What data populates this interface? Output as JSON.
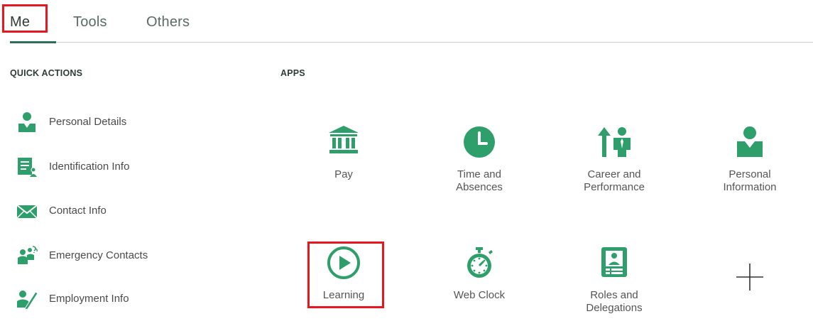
{
  "tabs": [
    {
      "label": "Me",
      "active": true
    },
    {
      "label": "Tools",
      "active": false
    },
    {
      "label": "Others",
      "active": false
    }
  ],
  "quick_actions": {
    "title": "QUICK ACTIONS",
    "items": [
      {
        "label": "Personal Details",
        "icon": "person-icon"
      },
      {
        "label": "Identification Info",
        "icon": "id-document-icon"
      },
      {
        "label": "Contact Info",
        "icon": "envelope-icon"
      },
      {
        "label": "Emergency Contacts",
        "icon": "contacts-group-icon"
      },
      {
        "label": "Employment Info",
        "icon": "person-edit-icon"
      }
    ]
  },
  "apps": {
    "title": "APPS",
    "items": [
      {
        "label_line1": "Pay",
        "label_line2": "",
        "icon": "bank-icon"
      },
      {
        "label_line1": "Time and",
        "label_line2": "Absences",
        "icon": "clock-icon"
      },
      {
        "label_line1": "Career and",
        "label_line2": "Performance",
        "icon": "career-arrow-person-icon"
      },
      {
        "label_line1": "Personal",
        "label_line2": "Information",
        "icon": "person-icon"
      },
      {
        "label_line1": "Learning",
        "label_line2": "",
        "icon": "play-circle-icon"
      },
      {
        "label_line1": "Web Clock",
        "label_line2": "",
        "icon": "stopwatch-icon"
      },
      {
        "label_line1": "Roles and",
        "label_line2": "Delegations",
        "icon": "badge-icon"
      },
      {
        "label_line1": "",
        "label_line2": "",
        "icon": "plus-icon"
      }
    ]
  },
  "colors": {
    "accent_green": "#2e9e6b",
    "highlight_red": "#e8171f",
    "tab_underline": "#2c6e5a"
  }
}
